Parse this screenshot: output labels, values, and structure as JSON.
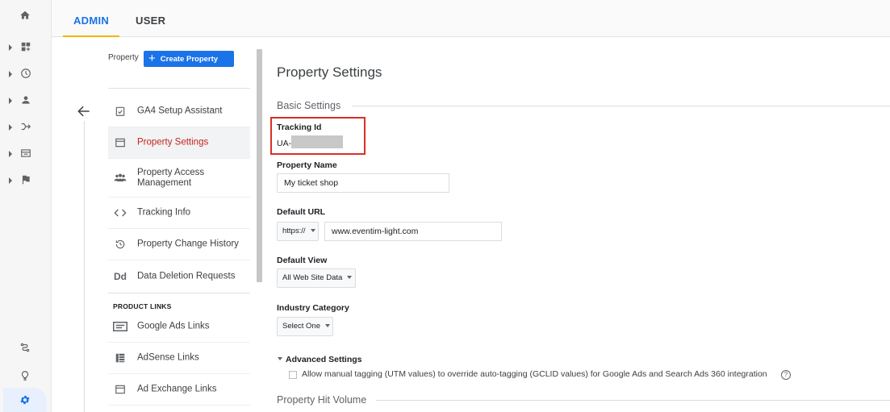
{
  "tabs": {
    "admin": "ADMIN",
    "user": "USER"
  },
  "property": {
    "label": "Property",
    "create_button": "Create Property"
  },
  "menu": {
    "items": [
      {
        "label": "GA4 Setup Assistant",
        "icon": "checklist-icon"
      },
      {
        "label": "Property Settings",
        "icon": "settings-window-icon",
        "active": true
      },
      {
        "label": "Property Access\nManagement",
        "icon": "people-icon"
      },
      {
        "label": "Tracking Info",
        "icon": "code-icon"
      },
      {
        "label": "Property Change History",
        "icon": "history-icon"
      },
      {
        "label": "Data Deletion Requests",
        "icon": "dd-icon"
      }
    ],
    "product_links_heading": "PRODUCT LINKS",
    "product_links": [
      {
        "label": "Google Ads Links",
        "icon": "ads-icon"
      },
      {
        "label": "AdSense Links",
        "icon": "adsense-icon"
      },
      {
        "label": "Ad Exchange Links",
        "icon": "adexchange-icon"
      }
    ]
  },
  "main": {
    "title": "Property Settings",
    "basic_settings": "Basic Settings",
    "tracking_id": {
      "label": "Tracking Id",
      "value": "UA-"
    },
    "property_name": {
      "label": "Property Name",
      "value": "My ticket shop"
    },
    "default_url": {
      "label": "Default URL",
      "protocol": "https://",
      "value": "www.eventim-light.com"
    },
    "default_view": {
      "label": "Default View",
      "value": "All Web Site Data"
    },
    "industry_category": {
      "label": "Industry Category",
      "value": "Select One"
    },
    "advanced_settings": "Advanced Settings",
    "manual_tagging": "Allow manual tagging (UTM values) to override auto-tagging (GCLID values) for Google Ads and Search Ads 360 integration",
    "help_glyph": "?",
    "hit_volume": "Property Hit Volume"
  },
  "colors": {
    "accent": "#1a73e8",
    "active_text": "#c5221f",
    "highlight_box": "#d93025",
    "tab_underline": "#f4b400"
  }
}
